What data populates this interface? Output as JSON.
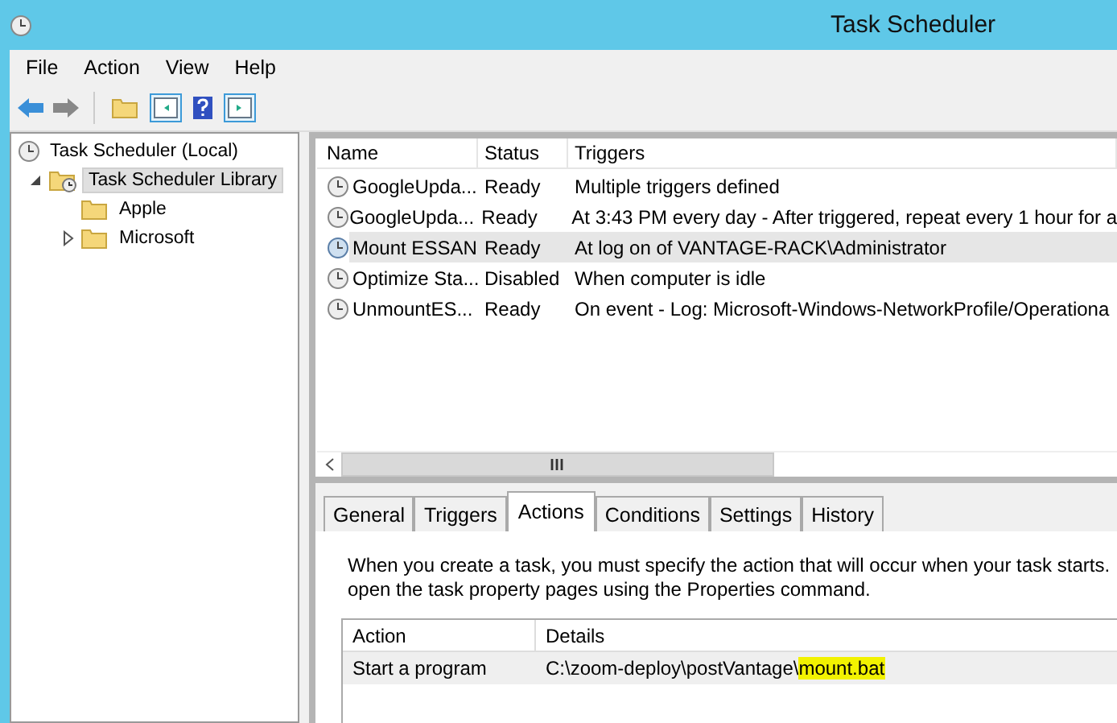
{
  "window": {
    "title": "Task Scheduler"
  },
  "menu": [
    "File",
    "Action",
    "View",
    "Help"
  ],
  "tree": [
    {
      "label": "Task Scheduler (Local)",
      "kind": "root",
      "selected": false,
      "children": [
        {
          "label": "Task Scheduler Library",
          "kind": "library",
          "selected": true,
          "expanded": true,
          "children": [
            {
              "label": "Apple",
              "kind": "folder",
              "selected": false
            },
            {
              "label": "Microsoft",
              "kind": "folder",
              "selected": false,
              "expanded": false
            }
          ]
        }
      ]
    }
  ],
  "task_table": {
    "columns": [
      "Name",
      "Status",
      "Triggers"
    ],
    "rows": [
      {
        "name": "GoogleUpda...",
        "status": "Ready",
        "triggers": "Multiple triggers defined",
        "selected": false
      },
      {
        "name": "GoogleUpda...",
        "status": "Ready",
        "triggers": "At 3:43 PM every day - After triggered, repeat every 1 hour for a",
        "selected": false
      },
      {
        "name": "Mount ESSAN",
        "status": "Ready",
        "triggers": "At log on of VANTAGE-RACK\\Administrator",
        "selected": true
      },
      {
        "name": "Optimize Sta...",
        "status": "Disabled",
        "triggers": "When computer is idle",
        "selected": false
      },
      {
        "name": "UnmountES...",
        "status": "Ready",
        "triggers": "On event - Log: Microsoft-Windows-NetworkProfile/Operationa",
        "selected": false
      }
    ]
  },
  "tabs": [
    {
      "label": "General",
      "selected": false
    },
    {
      "label": "Triggers",
      "selected": false
    },
    {
      "label": "Actions",
      "selected": true
    },
    {
      "label": "Conditions",
      "selected": false
    },
    {
      "label": "Settings",
      "selected": false
    },
    {
      "label": "History",
      "selected": false
    }
  ],
  "actions_tab": {
    "description": [
      "When you create a task, you must specify the action that will occur when your task starts.",
      "open the task property pages using the Properties command."
    ],
    "columns": [
      "Action",
      "Details"
    ],
    "rows": [
      {
        "action": "Start a program",
        "details": [
          {
            "text": "C:\\zoom-deploy\\postVantage\\",
            "highlighted": false
          },
          {
            "text": "mount.bat",
            "highlighted": true
          }
        ]
      }
    ]
  }
}
